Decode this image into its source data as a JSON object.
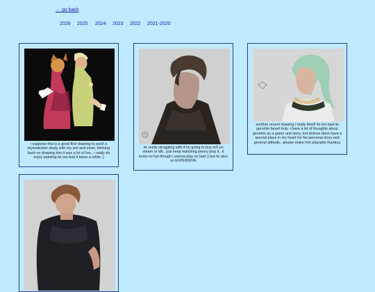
{
  "nav": {
    "back_label": "← go back",
    "years": [
      "2026",
      "2025",
      "2024",
      "2023",
      "2022",
      "2021-2020"
    ]
  },
  "posts": [
    {
      "caption": "i suppose this is a good first drawing to post! a leyendecker study with my wol and emet, thinking back on drawing this it was a lot of fun.. i really do enjoy painting its too bad it takes a while.;)",
      "bg": "#0b0b0b"
    },
    {
      "caption": "im really struggling with if im going to buy re9 on steam or idk.. just keep watching penny play it.. it looks so fun though i wanna play so bad.;) but its also so EXPENSIVE",
      "bg": "#d0d0d0"
    },
    {
      "caption": "another recent drawing i really liked! its too bad its genshin fanart truly. i have a lot of thoughts about genshin as a game and story, but dottore does have a special place in my heart for his personal story and general attitude.. please make him playable thankuu",
      "bg": "#d6d6d6"
    },
    {
      "caption": "",
      "bg": "#d2d2d2"
    }
  ]
}
